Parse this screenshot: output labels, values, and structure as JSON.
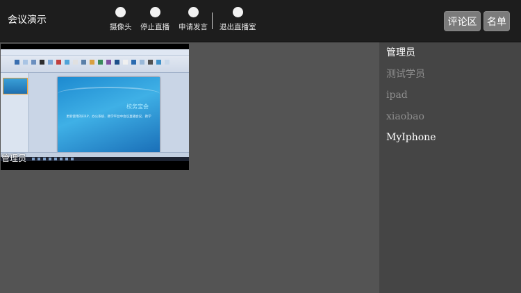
{
  "header": {
    "title": "会议演示",
    "controls": [
      {
        "label": "摄像头",
        "icon": "circle-icon"
      },
      {
        "label": "停止直播",
        "icon": "circle-icon"
      },
      {
        "label": "申请发言",
        "icon": "circle-icon"
      },
      {
        "label": "退出直播室",
        "icon": "circle-icon"
      }
    ],
    "buttons": {
      "comments": "评论区",
      "roster": "名单"
    }
  },
  "video": {
    "owner_label": "管理员",
    "slide_title": "校务宝会",
    "slide_subtitle": "更新使用的ERP、办公系统、教学平台中会议直播会议、教学"
  },
  "participants": [
    {
      "name": "管理员",
      "state": "active"
    },
    {
      "name": "测试学员",
      "state": "inactive"
    },
    {
      "name": "ipad",
      "state": "inactive"
    },
    {
      "name": "xiaobao",
      "state": "inactive"
    },
    {
      "name": "MyIphone",
      "state": "active"
    }
  ],
  "colors": {
    "topbar": "#1d1d1d",
    "main_bg": "#545454",
    "panel_bg": "#454545",
    "button_bg": "#7b7b7b"
  }
}
